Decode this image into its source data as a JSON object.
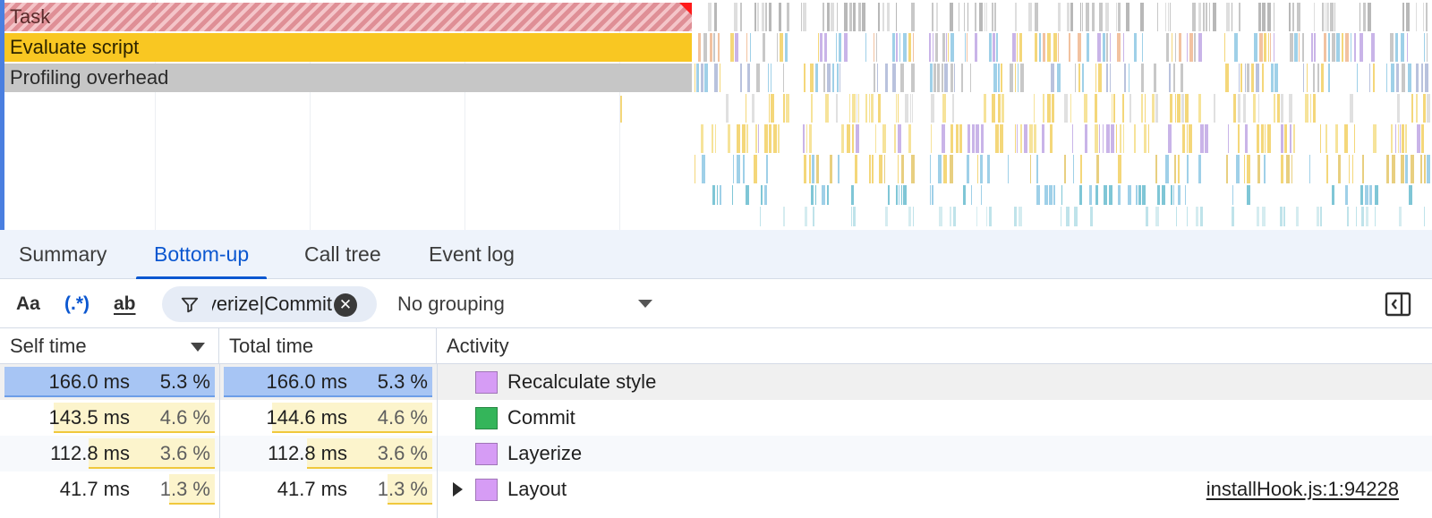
{
  "flame": {
    "tracks": [
      {
        "label": "Task",
        "color": "#e0979d"
      },
      {
        "label": "Evaluate script",
        "color": "#f9c722"
      },
      {
        "label": "Profiling overhead",
        "color": "#c6c6c6"
      }
    ]
  },
  "tabs": [
    {
      "label": "Summary",
      "active": false
    },
    {
      "label": "Bottom-up",
      "active": true
    },
    {
      "label": "Call tree",
      "active": false
    },
    {
      "label": "Event log",
      "active": false
    }
  ],
  "toolbar": {
    "match_case_label": "Aa",
    "regex_label": "(.*)",
    "whole_word_label": "ab",
    "filter_text": "Recalculate style|Layerize|Commit",
    "clear_icon": "close-circle-icon",
    "filter_icon": "funnel-icon",
    "grouping_value": "No grouping",
    "sidebar_icon": "sidebar-toggle-icon"
  },
  "table": {
    "headers": {
      "self": "Self time",
      "total": "Total time",
      "activity": "Activity"
    },
    "rows": [
      {
        "self_ms": "166.0 ms",
        "self_pct": "5.3 %",
        "self_frac": 0.053,
        "total_ms": "166.0 ms",
        "total_pct": "5.3 %",
        "total_frac": 0.053,
        "activity": "Recalculate style",
        "color": "#d69cf5",
        "expandable": false,
        "link": "",
        "selected": true
      },
      {
        "self_ms": "143.5 ms",
        "self_pct": "4.6 %",
        "self_frac": 0.046,
        "total_ms": "144.6 ms",
        "total_pct": "4.6 %",
        "total_frac": 0.046,
        "activity": "Commit",
        "color": "#34b55a",
        "expandable": false,
        "link": "",
        "selected": false
      },
      {
        "self_ms": "112.8 ms",
        "self_pct": "3.6 %",
        "self_frac": 0.036,
        "total_ms": "112.8 ms",
        "total_pct": "3.6 %",
        "total_frac": 0.036,
        "activity": "Layerize",
        "color": "#d69cf5",
        "expandable": false,
        "link": "",
        "selected": false
      },
      {
        "self_ms": "41.7 ms",
        "self_pct": "1.3 %",
        "self_frac": 0.013,
        "total_ms": "41.7 ms",
        "total_pct": "1.3 %",
        "total_frac": 0.013,
        "activity": "Layout",
        "color": "#d69cf5",
        "expandable": true,
        "link": "installHook.js:1:94228",
        "selected": false
      }
    ]
  }
}
